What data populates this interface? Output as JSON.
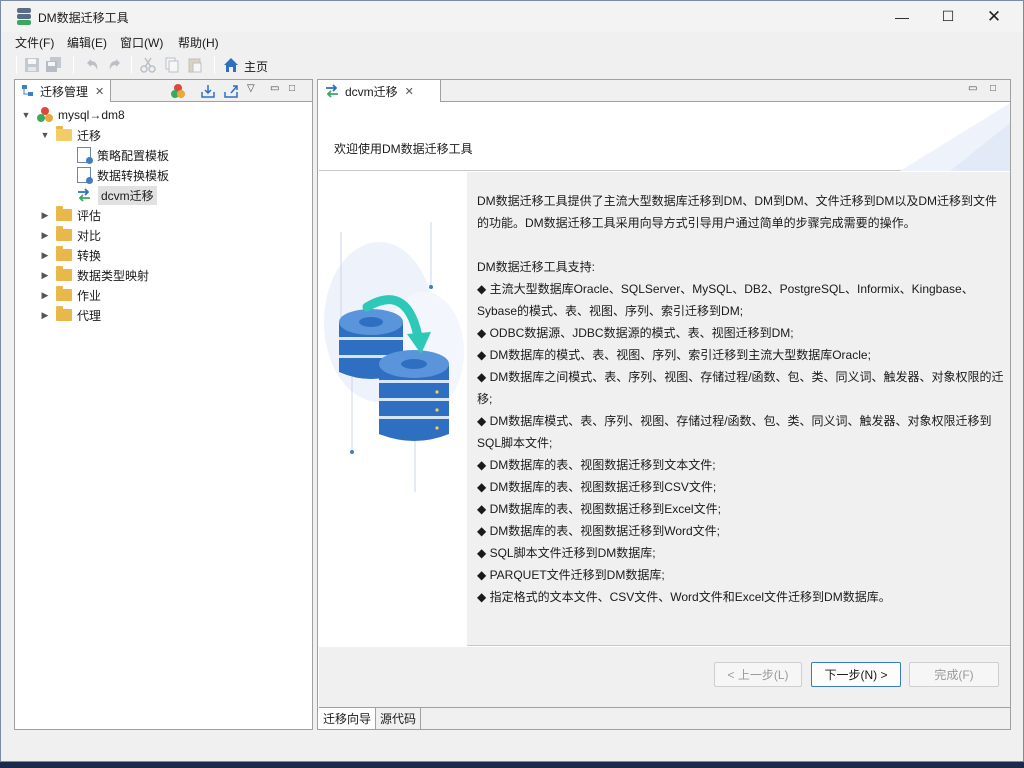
{
  "window": {
    "title": "DM数据迁移工具"
  },
  "menu": [
    "文件(F)",
    "编辑(E)",
    "窗口(W)",
    "帮助(H)"
  ],
  "toolbar": {
    "home_label": "主页"
  },
  "left_panel": {
    "tab_label": "迁移管理",
    "tree": {
      "root": "mysql→dm8",
      "migration_folder": "迁移",
      "migration_children": [
        "策略配置模板",
        "数据转换模板",
        "dcvm迁移"
      ],
      "folders": [
        "评估",
        "对比",
        "转换",
        "数据类型映射",
        "作业",
        "代理"
      ]
    }
  },
  "editor": {
    "tab_label": "dcvm迁移",
    "welcome": "欢迎使用DM数据迁移工具",
    "description": [
      "DM数据迁移工具提供了主流大型数据库迁移到DM、DM到DM、文件迁移到DM以及DM迁移到文件的功能。DM数据迁移工具采用向导方式引导用户通过简单的步骤完成需要的操作。",
      "",
      " DM数据迁移工具支持:",
      "◆ 主流大型数据库Oracle、SQLServer、MySQL、DB2、PostgreSQL、Informix、Kingbase、Sybase的模式、表、视图、序列、索引迁移到DM;",
      "◆ ODBC数据源、JDBC数据源的模式、表、视图迁移到DM;",
      "◆ DM数据库的模式、表、视图、序列、索引迁移到主流大型数据库Oracle;",
      "◆ DM数据库之间模式、表、序列、视图、存储过程/函数、包、类、同义词、触发器、对象权限的迁移;",
      "◆ DM数据库模式、表、序列、视图、存储过程/函数、包、类、同义词、触发器、对象权限迁移到SQL脚本文件;",
      "◆ DM数据库的表、视图数据迁移到文本文件;",
      "◆ DM数据库的表、视图数据迁移到CSV文件;",
      "◆ DM数据库的表、视图数据迁移到Excel文件;",
      "◆ DM数据库的表、视图数据迁移到Word文件;",
      "◆ SQL脚本文件迁移到DM数据库;",
      "◆ PARQUET文件迁移到DM数据库;",
      "◆ 指定格式的文本文件、CSV文件、Word文件和Excel文件迁移到DM数据库。"
    ],
    "buttons": {
      "back": "< 上一步(L)",
      "next": "下一步(N) >",
      "finish": "完成(F)"
    },
    "bottom_tabs": [
      "迁移向导",
      "源代码"
    ]
  }
}
